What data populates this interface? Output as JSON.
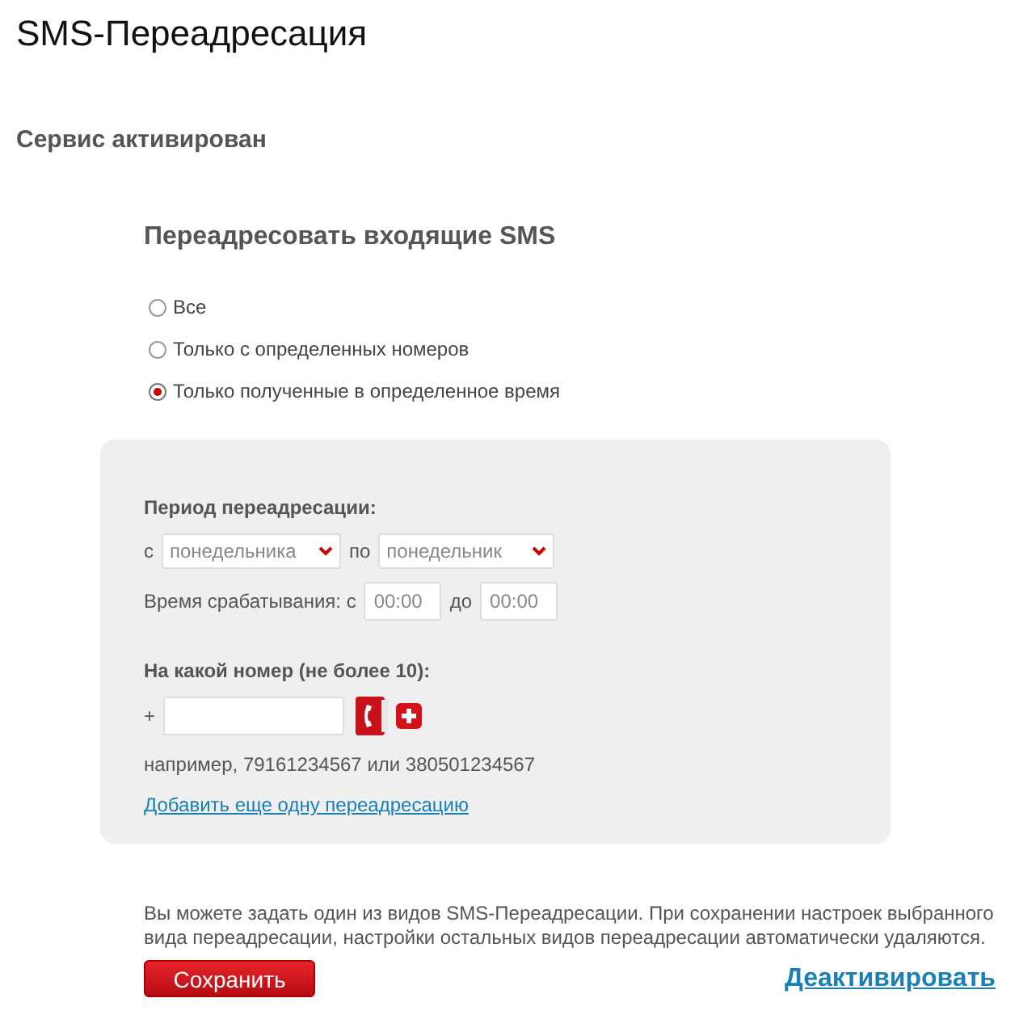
{
  "page_title": "SMS-Переадресация",
  "status": "Сервис активирован",
  "section_title": "Переадресовать входящие SMS",
  "options": [
    {
      "label": "Все",
      "selected": false
    },
    {
      "label": "Только с определенных номеров",
      "selected": false
    },
    {
      "label": "Только полученные в определенное время",
      "selected": true
    }
  ],
  "panel": {
    "period_label": "Период переадресации:",
    "from_label": "с",
    "from_day": "понедельника",
    "to_label": "по",
    "to_day": "понедельник",
    "time_label": "Время срабатывания: с",
    "time_from": "00:00",
    "time_to_label": "до",
    "time_to": "00:00",
    "number_label": "На какой номер (не более 10):",
    "plus": "+",
    "example": "например, 79161234567 или 380501234567",
    "add_link": "Добавить еще одну переадресацию"
  },
  "note": "Вы можете задать один из видов SMS-Переадресации. При сохранении настроек выбранного вида переадресации, настройки остальных видов переадресации автоматически удаляются.",
  "save_button": "Сохранить",
  "deactivate_link": "Деактивировать"
}
